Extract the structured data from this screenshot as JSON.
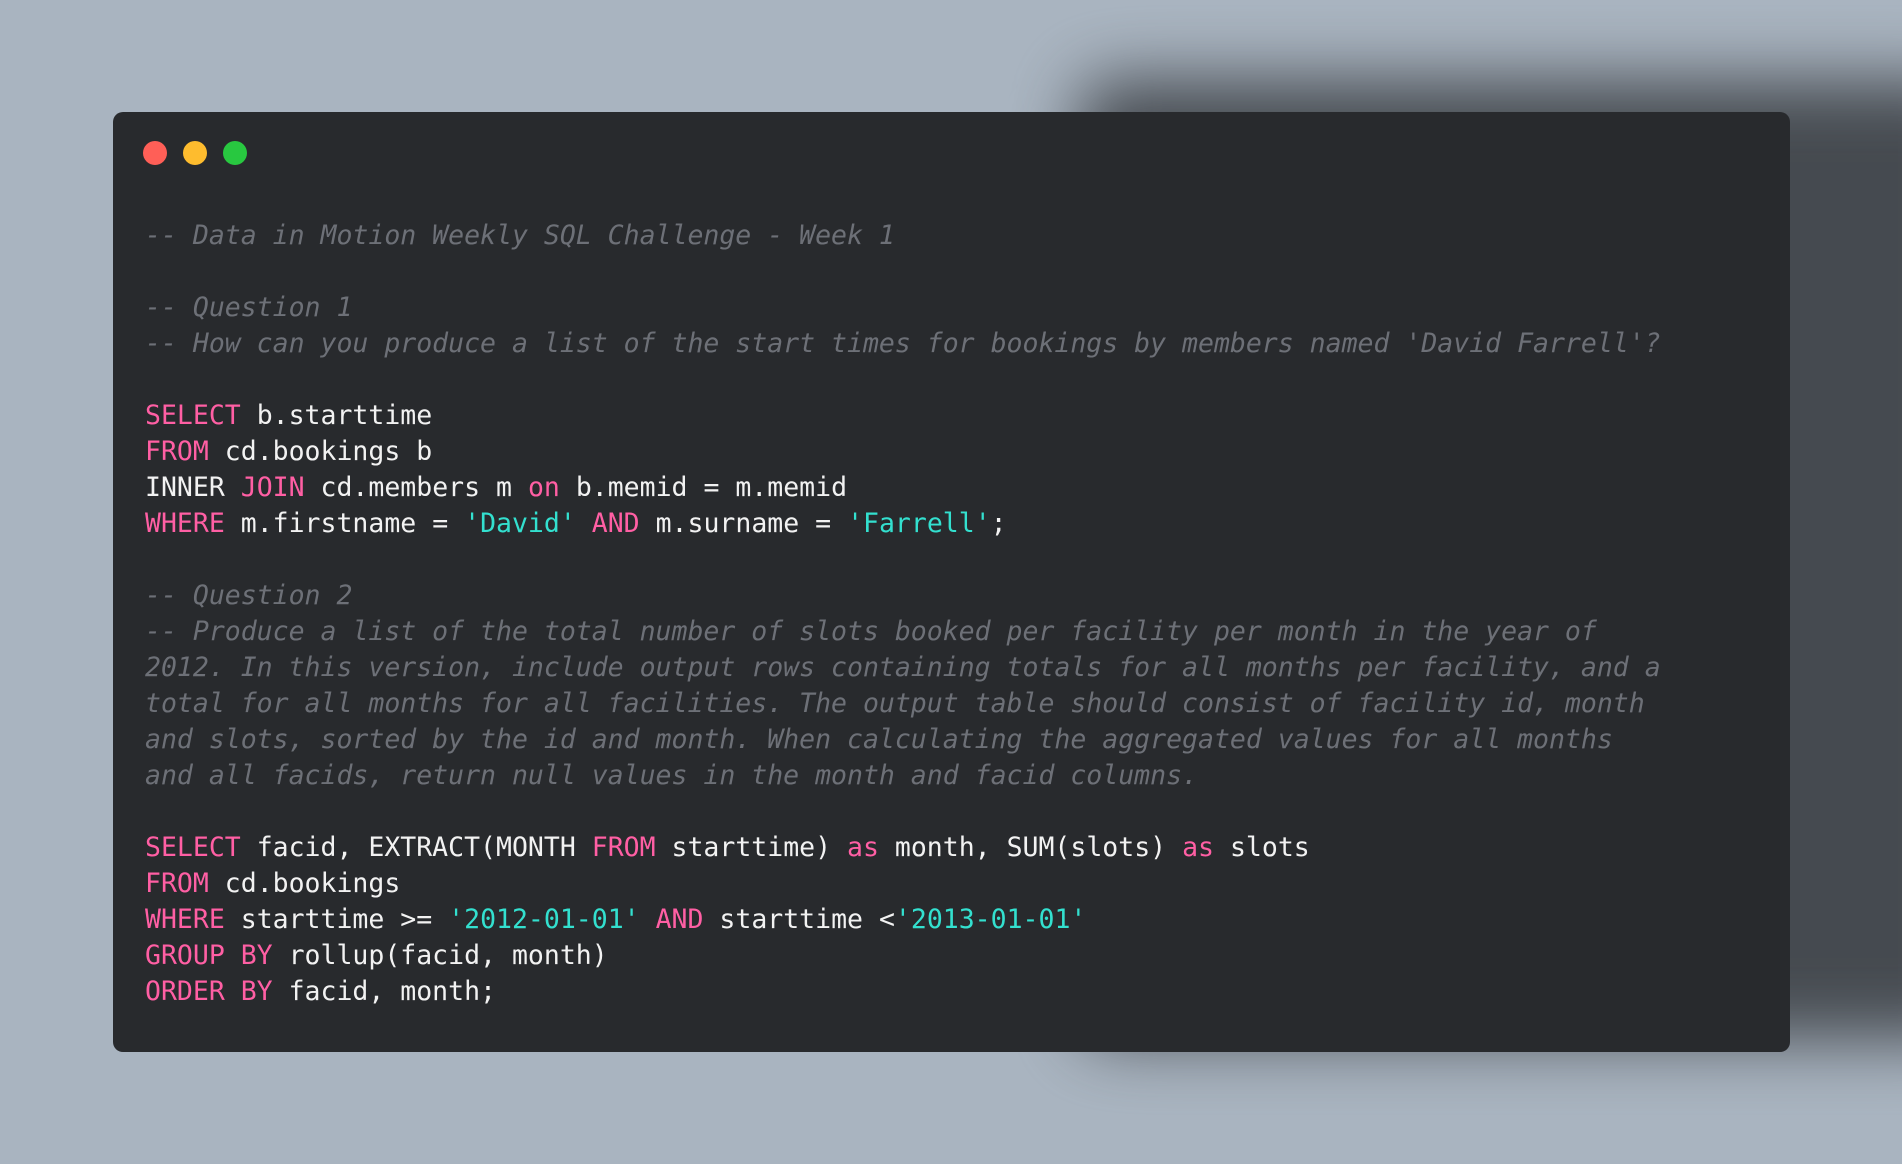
{
  "window": {
    "controls": [
      {
        "name": "close-window-button",
        "color": "#ff5f57"
      },
      {
        "name": "minimize-window-button",
        "color": "#febc2e"
      },
      {
        "name": "maximize-window-button",
        "color": "#28c840"
      }
    ],
    "colors": {
      "background": "#282a2d",
      "page_background": "#a9b4c0",
      "keyword": "#ff5fa4",
      "string": "#33e0cf",
      "comment": "#6d7077",
      "plain": "#f2f2f2"
    }
  },
  "code_lines": [
    [
      {
        "t": "comment",
        "v": "-- Data in Motion Weekly SQL Challenge - Week 1"
      }
    ],
    [],
    [
      {
        "t": "comment",
        "v": "-- Question 1"
      }
    ],
    [
      {
        "t": "comment",
        "v": "-- How can you produce a list of the start times for bookings by members named 'David Farrell'?"
      }
    ],
    [],
    [
      {
        "t": "keyword",
        "v": "SELECT"
      },
      {
        "t": "plain",
        "v": " b.starttime"
      }
    ],
    [
      {
        "t": "keyword",
        "v": "FROM"
      },
      {
        "t": "plain",
        "v": " cd.bookings b"
      }
    ],
    [
      {
        "t": "plain",
        "v": "INNER "
      },
      {
        "t": "keyword",
        "v": "JOIN"
      },
      {
        "t": "plain",
        "v": " cd.members m "
      },
      {
        "t": "keyword",
        "v": "on"
      },
      {
        "t": "plain",
        "v": " b.memid = m.memid"
      }
    ],
    [
      {
        "t": "keyword",
        "v": "WHERE"
      },
      {
        "t": "plain",
        "v": " m.firstname = "
      },
      {
        "t": "string",
        "v": "'David'"
      },
      {
        "t": "plain",
        "v": " "
      },
      {
        "t": "keyword",
        "v": "AND"
      },
      {
        "t": "plain",
        "v": " m.surname = "
      },
      {
        "t": "string",
        "v": "'Farrell'"
      },
      {
        "t": "plain",
        "v": ";"
      }
    ],
    [],
    [
      {
        "t": "comment",
        "v": "-- Question 2"
      }
    ],
    [
      {
        "t": "comment",
        "v": "-- Produce a list of the total number of slots booked per facility per month in the year of"
      }
    ],
    [
      {
        "t": "comment",
        "v": "2012. In this version, include output rows containing totals for all months per facility, and a"
      }
    ],
    [
      {
        "t": "comment",
        "v": "total for all months for all facilities. The output table should consist of facility id, month"
      }
    ],
    [
      {
        "t": "comment",
        "v": "and slots, sorted by the id and month. When calculating the aggregated values for all months"
      }
    ],
    [
      {
        "t": "comment",
        "v": "and all facids, return null values in the month and facid columns."
      }
    ],
    [],
    [
      {
        "t": "keyword",
        "v": "SELECT"
      },
      {
        "t": "plain",
        "v": " facid, EXTRACT(MONTH "
      },
      {
        "t": "keyword",
        "v": "FROM"
      },
      {
        "t": "plain",
        "v": " starttime) "
      },
      {
        "t": "keyword",
        "v": "as"
      },
      {
        "t": "plain",
        "v": " month, SUM(slots) "
      },
      {
        "t": "keyword",
        "v": "as"
      },
      {
        "t": "plain",
        "v": " slots"
      }
    ],
    [
      {
        "t": "keyword",
        "v": "FROM"
      },
      {
        "t": "plain",
        "v": " cd.bookings"
      }
    ],
    [
      {
        "t": "keyword",
        "v": "WHERE"
      },
      {
        "t": "plain",
        "v": " starttime >= "
      },
      {
        "t": "string",
        "v": "'2012-01-01'"
      },
      {
        "t": "plain",
        "v": " "
      },
      {
        "t": "keyword",
        "v": "AND"
      },
      {
        "t": "plain",
        "v": " starttime <"
      },
      {
        "t": "string",
        "v": "'2013-01-01'"
      }
    ],
    [
      {
        "t": "keyword",
        "v": "GROUP BY"
      },
      {
        "t": "plain",
        "v": " rollup(facid, month)"
      }
    ],
    [
      {
        "t": "keyword",
        "v": "ORDER BY"
      },
      {
        "t": "plain",
        "v": " facid, month;"
      }
    ]
  ]
}
